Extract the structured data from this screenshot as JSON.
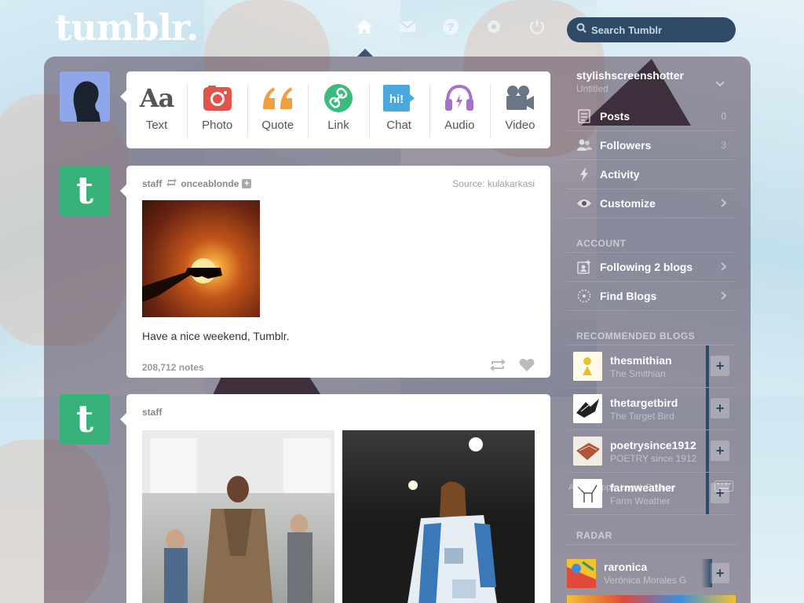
{
  "app": {
    "logo_text": "tumblr."
  },
  "nav": {
    "icons": [
      "home-icon",
      "mail-icon",
      "help-icon",
      "settings-icon",
      "power-icon"
    ]
  },
  "search": {
    "placeholder": "Search Tumblr"
  },
  "post_types": [
    {
      "label": "Text",
      "icon": "text-icon",
      "color": "#555555"
    },
    {
      "label": "Photo",
      "icon": "camera-icon",
      "color": "#e0544a"
    },
    {
      "label": "Quote",
      "icon": "quote-icon",
      "color": "#f0a040"
    },
    {
      "label": "Link",
      "icon": "link-icon",
      "color": "#3bbc7c"
    },
    {
      "label": "Chat",
      "icon": "chat-icon",
      "color": "#4aa8e0"
    },
    {
      "label": "Audio",
      "icon": "headphones-icon",
      "color": "#a672c9"
    },
    {
      "label": "Video",
      "icon": "video-icon",
      "color": "#6b7685"
    }
  ],
  "posts": [
    {
      "author": "staff",
      "reblogged_from": "onceablonde",
      "source_label": "Source:",
      "source": "kulakarkasi",
      "caption": "Have a nice weekend, Tumblr.",
      "notes": "208,712 notes"
    },
    {
      "author": "staff"
    }
  ],
  "sidebar": {
    "blog": {
      "name": "stylishscreenshotter",
      "title": "Untitled"
    },
    "menu": [
      {
        "label": "Posts",
        "count": "0",
        "icon": "posts-icon"
      },
      {
        "label": "Followers",
        "count": "3",
        "icon": "followers-icon"
      },
      {
        "label": "Activity",
        "icon": "lightning-icon"
      },
      {
        "label": "Customize",
        "icon": "eye-icon"
      }
    ],
    "account_heading": "ACCOUNT",
    "account": [
      {
        "label": "Following 2 blogs",
        "icon": "following-icon"
      },
      {
        "label": "Find Blogs",
        "icon": "compass-icon"
      }
    ],
    "recommended_heading": "RECOMMENDED BLOGS",
    "recommended": [
      {
        "name": "thesmithian",
        "title": "The Smithian"
      },
      {
        "name": "thetargetbird",
        "title": "The Target Bird"
      },
      {
        "name": "poetrysince1912",
        "title": "POETRY since 1912"
      },
      {
        "name": "farmweather",
        "title": "Farm Weather"
      }
    ],
    "footer": [
      "About",
      "Apps",
      "Legal",
      "Privacy"
    ],
    "radar_heading": "RADAR",
    "radar": {
      "name": "raronica",
      "title": "Verónica Morales G"
    }
  }
}
